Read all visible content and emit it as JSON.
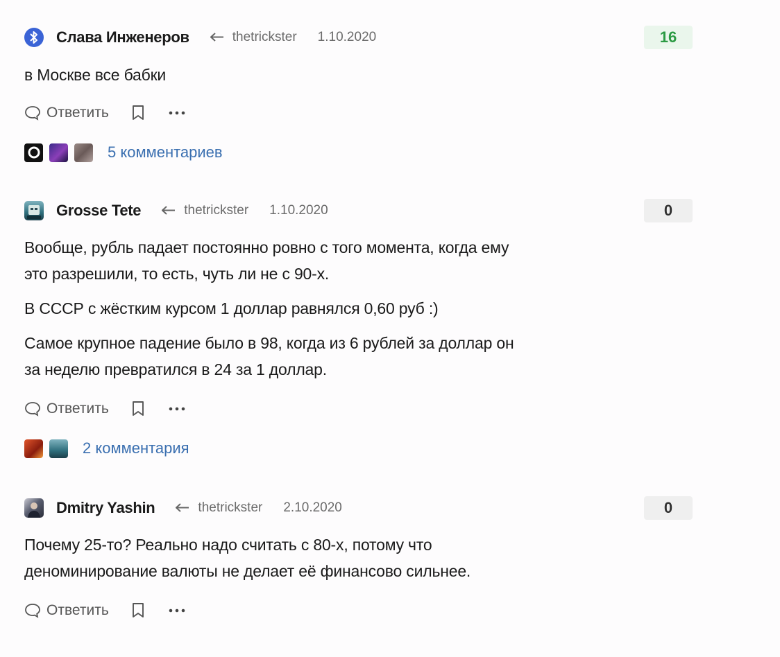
{
  "reply_label": "Ответить",
  "comments": [
    {
      "author": "Слава Инженеров",
      "reply_to": "thetrickster",
      "date": "1.10.2020",
      "rating": "16",
      "paragraphs": [
        "в Москве все бабки"
      ],
      "thread_text": "5 комментариев"
    },
    {
      "author": "Grosse Tete",
      "reply_to": "thetrickster",
      "date": "1.10.2020",
      "rating": "0",
      "paragraphs": [
        "Вообще, рубль падает постоянно ровно с того момента, когда ему",
        "это разрешили, то есть, чуть ли не с 90-х.",
        "В СССР с жёстким курсом 1 доллар равнялся 0,60 руб :)",
        "Самое крупное падение было в 98, когда из 6 рублей за доллар он",
        "за неделю превратился в 24 за 1 доллар."
      ],
      "thread_text": "2 комментария"
    },
    {
      "author": "Dmitry Yashin",
      "reply_to": "thetrickster",
      "date": "2.10.2020",
      "rating": "0",
      "paragraphs": [
        "Почему 25-то? Реально надо считать с 80-х, потому что",
        "деноминирование валюты не делает её финансово сильнее."
      ]
    }
  ],
  "colors": {
    "rating_positive": "#2b9a43",
    "thread_link": "#3a6fb0"
  }
}
